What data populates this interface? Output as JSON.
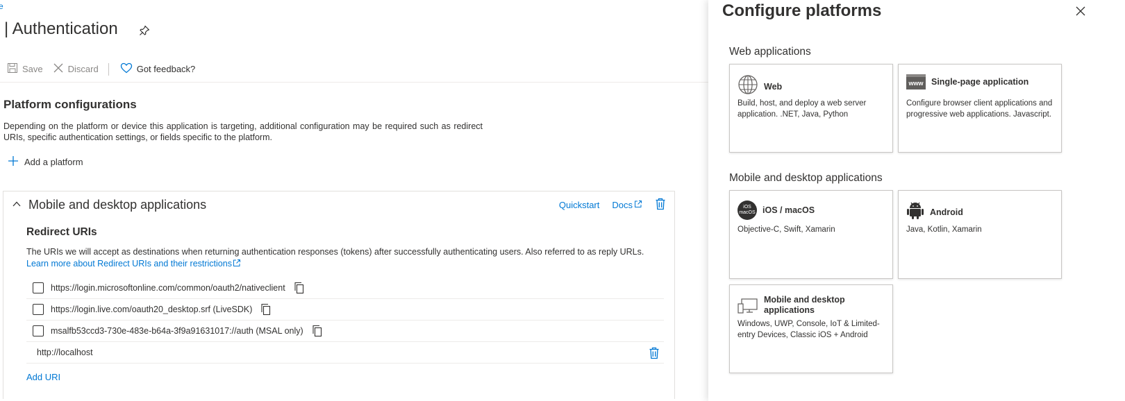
{
  "breadcrumb": "e",
  "page_title": "| Authentication",
  "toolbar": {
    "save": "Save",
    "discard": "Discard",
    "feedback": "Got feedback?"
  },
  "platform_configurations": {
    "title": "Platform configurations",
    "description": "Depending on the platform or device this application is targeting, additional configuration may be required such as redirect URIs, specific authentication settings, or fields specific to the platform.",
    "add_platform": "Add a platform"
  },
  "mobile_card": {
    "title": "Mobile and desktop applications",
    "quickstart": "Quickstart",
    "docs": "Docs",
    "redirect_title": "Redirect URIs",
    "redirect_desc": "The URIs we will accept as destinations when returning authentication responses (tokens) after successfully authenticating users. Also referred to as reply URLs. ",
    "learn_more": "Learn more about Redirect URIs and their restrictions",
    "uris": [
      "https://login.microsoftonline.com/common/oauth2/nativeclient",
      "https://login.live.com/oauth20_desktop.srf (LiveSDK)",
      "msalfb53ccd3-730e-483e-b64a-3f9a91631017://auth (MSAL only)"
    ],
    "custom_uri": "http://localhost",
    "add_uri": "Add URI"
  },
  "panel": {
    "title": "Configure platforms",
    "web_section": "Web applications",
    "mobile_section": "Mobile and desktop applications",
    "tiles": {
      "web": {
        "name": "Web",
        "desc": "Build, host, and deploy a web server application. .NET, Java, Python"
      },
      "spa": {
        "name": "Single-page application",
        "desc": "Configure browser client applications and progressive web applications. Javascript.",
        "icon_text": "www"
      },
      "ios": {
        "name": "iOS / macOS",
        "desc": "Objective-C, Swift, Xamarin",
        "icon_text_1": "iOS",
        "icon_text_2": "macOS"
      },
      "android": {
        "name": "Android",
        "desc": "Java, Kotlin, Xamarin"
      },
      "desktop": {
        "name": "Mobile and desktop applications",
        "desc": "Windows, UWP, Console, IoT & Limited-entry Devices, Classic iOS + Android"
      }
    }
  },
  "colors": {
    "accent": "#0078d4",
    "text": "#323130",
    "disabled": "#8a8886"
  }
}
